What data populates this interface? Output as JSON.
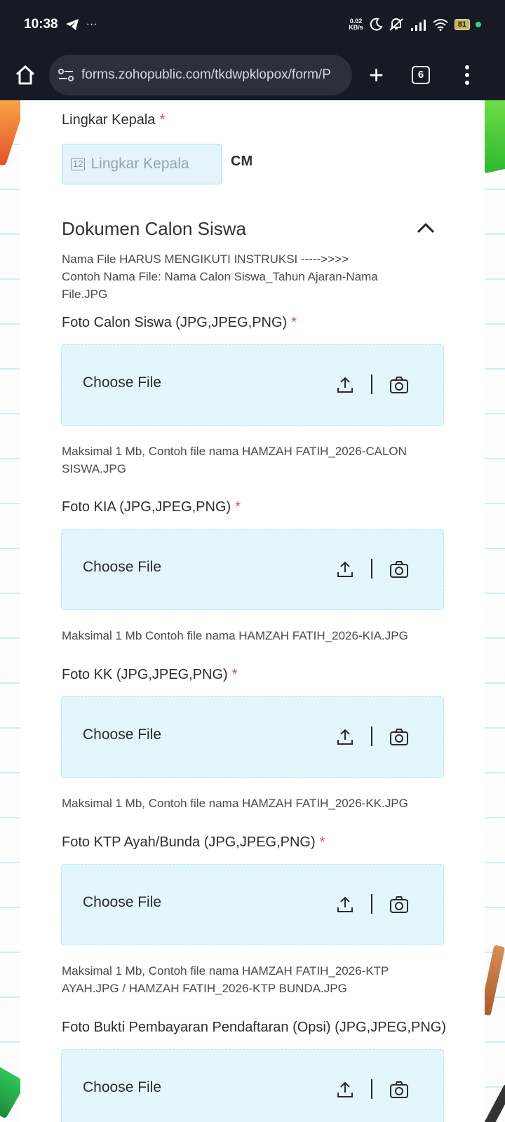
{
  "status_bar": {
    "time": "10:38",
    "speed_value": "0.02",
    "speed_unit": "KB/s",
    "battery": "81"
  },
  "browser": {
    "url": "forms.zohopublic.com/tkdwpklopox/form/P",
    "tab_count": "6"
  },
  "form": {
    "head_circ": {
      "label": "Lingkar Kepala",
      "required_mark": "*",
      "placeholder": "Lingkar Kepala",
      "icon_text": "12",
      "unit": "CM"
    },
    "section": {
      "title": "Dokumen Calon Siswa",
      "instruction_line1": "Nama File HARUS MENGIKUTI INSTRUKSI ----->>>>",
      "instruction_line2": "Contoh Nama File: Nama Calon Siswa_Tahun Ajaran-Nama File.JPG"
    },
    "uploads": [
      {
        "label": "Foto Calon Siswa (JPG,JPEG,PNG)",
        "required_mark": "*",
        "button": "Choose File",
        "help": "Maksimal 1 Mb, Contoh file nama HAMZAH FATIH_2026-CALON SISWA.JPG"
      },
      {
        "label": "Foto KIA (JPG,JPEG,PNG)",
        "required_mark": "*",
        "button": "Choose File",
        "help": "Maksimal 1 Mb Contoh file nama HAMZAH FATIH_2026-KIA.JPG"
      },
      {
        "label": "Foto KK (JPG,JPEG,PNG)",
        "required_mark": "*",
        "button": "Choose File",
        "help": "Maksimal 1 Mb, Contoh file nama HAMZAH FATIH_2026-KK.JPG"
      },
      {
        "label": "Foto KTP Ayah/Bunda (JPG,JPEG,PNG)",
        "required_mark": "*",
        "button": "Choose File",
        "help": "Maksimal 1 Mb, Contoh file nama HAMZAH FATIH_2026-KTP AYAH.JPG / HAMZAH FATIH_2026-KTP BUNDA.JPG"
      },
      {
        "label": "Foto Bukti Pembayaran Pendaftaran (Opsi) (JPG,JPEG,PNG)",
        "button": "Choose File"
      }
    ]
  }
}
